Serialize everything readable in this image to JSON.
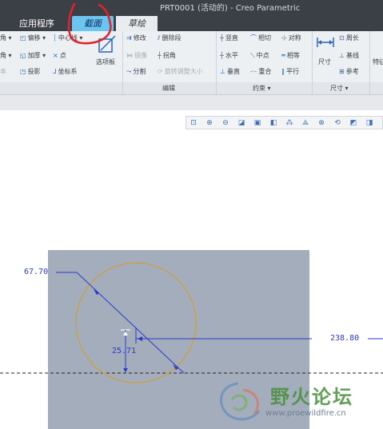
{
  "window": {
    "title": "PRT0001 (活动的) - Creo Parametric"
  },
  "tabs": [
    {
      "label": "应用程序"
    },
    {
      "label": "截面"
    },
    {
      "label": "草绘"
    }
  ],
  "ribbon": {
    "col1": [
      "角 ▾",
      "角 ▾",
      "本"
    ],
    "col2": [
      "偏移",
      "加厚",
      "投影"
    ],
    "col3": [
      "中心线 ▾",
      "点",
      "坐标系"
    ],
    "palette": "选项板",
    "edit": {
      "modify": "修改",
      "mirror": "镜像",
      "divide": "分割",
      "delete_segment": "删除段",
      "corner": "拐角",
      "rotate_resize": "旋转调整大小"
    },
    "constrain": {
      "vertical": "竖直",
      "horizontal": "水平",
      "perpendicular": "垂直",
      "tangent": "相切",
      "midpoint": "中点",
      "coincident": "重合",
      "symmetric": "对称",
      "equal": "相等",
      "parallel": "平行"
    },
    "dimension": {
      "dimension": "尺寸",
      "perimeter": "周长",
      "baseline": "基线",
      "reference": "参考"
    },
    "feature": "特征"
  },
  "groups": {
    "edit": "编辑",
    "constrain": "约束 ▾",
    "dimension": "尺寸 ▾"
  },
  "view_toolbar": [
    "refit-icon",
    "zoom-in-icon",
    "zoom-out-icon",
    "repaint-icon",
    "named-views-icon",
    "display-style-icon",
    "datum-display-icon",
    "sketch-display-icon",
    "annotation-display-icon",
    "spin-center-icon",
    "sketch-view-icon",
    "more-icon"
  ],
  "sketch": {
    "dimensions": {
      "d1": "67.70",
      "d2": "25.71",
      "d3": "238.80"
    }
  },
  "watermark": {
    "name": "野火论坛",
    "url": "www.proewildfire.cn"
  },
  "colors": {
    "section_tab": "#6cc5f0",
    "annotation": "#e0242a",
    "dimension": "#2a3ac8",
    "circle": "#c9a04a",
    "plane": "#a4adbb"
  }
}
